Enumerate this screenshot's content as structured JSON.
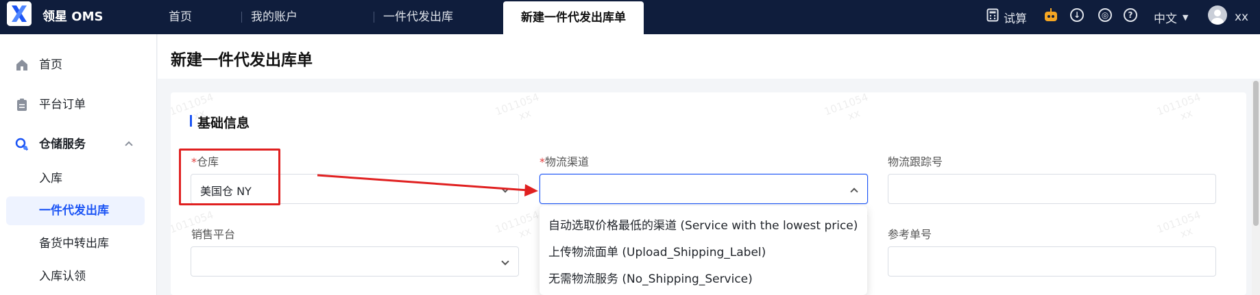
{
  "app": {
    "brand": "领星 OMS"
  },
  "top_nav": {
    "tabs": [
      {
        "label": "首页"
      },
      {
        "label": "我的账户"
      },
      {
        "label": "一件代发出库"
      },
      {
        "label": "新建一件代发出库单"
      }
    ],
    "trial_label": "试算",
    "language": "中文",
    "user": "xx"
  },
  "sidebar": {
    "items": [
      {
        "label": "首页",
        "icon": "home-icon"
      },
      {
        "label": "平台订单",
        "icon": "clipboard-icon"
      },
      {
        "label": "仓储服务",
        "icon": "warehouse-service-icon"
      }
    ],
    "sub_items": [
      {
        "label": "入库"
      },
      {
        "label": "一件代发出库"
      },
      {
        "label": "备货中转出库"
      },
      {
        "label": "入库认领"
      }
    ]
  },
  "page": {
    "title": "新建一件代发出库单",
    "section_title": "基础信息"
  },
  "form": {
    "warehouse": {
      "label": "仓库",
      "required_mark": "*",
      "value": "美国仓 NY"
    },
    "logistics_channel": {
      "label": "物流渠道",
      "required_mark": "*",
      "value": ""
    },
    "tracking_no": {
      "label": "物流跟踪号",
      "value": ""
    },
    "sales_platform": {
      "label": "销售平台",
      "value": ""
    },
    "reference_no": {
      "label": "参考单号",
      "value": ""
    }
  },
  "dropdown_options": [
    "自动选取价格最低的渠道 (Service with the lowest price)",
    "上传物流面单 (Upload_Shipping_Label)",
    "无需物流服务 (No_Shipping_Service)"
  ],
  "watermark": {
    "number": "1011054",
    "user": "xx"
  },
  "colors": {
    "topbar_bg": "#0f1d3c",
    "accent": "#1b54f5",
    "annotation_red": "#e02020",
    "required_star": "#e23b3b"
  }
}
